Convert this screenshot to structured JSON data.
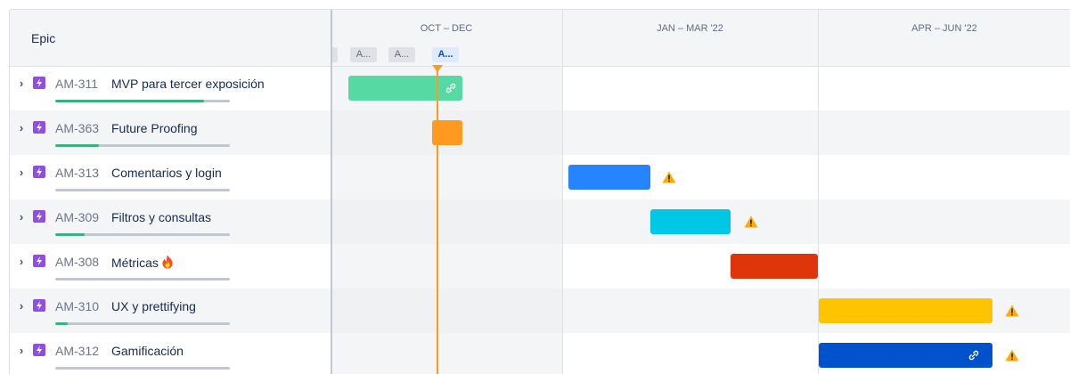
{
  "header": {
    "epic_column_title": "Epic"
  },
  "timeline": {
    "quarters": [
      {
        "label": "OCT – DEC"
      },
      {
        "label": "JAN – MAR '22"
      },
      {
        "label": "APR – JUN '22"
      }
    ],
    "months": [
      {
        "label": "A..."
      },
      {
        "label": "A..."
      },
      {
        "label": "A...",
        "current": true
      }
    ],
    "today_color": "#ff991f"
  },
  "epics": [
    {
      "key": "AM-311",
      "summary": "MVP para tercer exposición",
      "progress": 0.85,
      "progress_color": "#36b37e",
      "bar_color": "#57d9a3",
      "has_link": true,
      "has_warning": false
    },
    {
      "key": "AM-363",
      "summary": "Future Proofing",
      "progress": 0.25,
      "progress_color": "#36b37e",
      "bar_color": "#ff991f",
      "has_link": false,
      "has_warning": false
    },
    {
      "key": "AM-313",
      "summary": "Comentarios y login",
      "progress": 0.0,
      "progress_color": "#36b37e",
      "bar_color": "#2684ff",
      "has_link": false,
      "has_warning": true
    },
    {
      "key": "AM-309",
      "summary": "Filtros y consultas",
      "progress": 0.17,
      "progress_color": "#36b37e",
      "bar_color": "#00c7e6",
      "has_link": false,
      "has_warning": true
    },
    {
      "key": "AM-308",
      "summary": "Métricas",
      "summary_icon": "fire-emoji-icon",
      "progress": 0.0,
      "progress_color": "#36b37e",
      "bar_color": "#de350b",
      "has_link": false,
      "has_warning": false
    },
    {
      "key": "AM-310",
      "summary": "UX y prettifying",
      "progress": 0.07,
      "progress_color": "#36b37e",
      "bar_color": "#ffc400",
      "has_link": false,
      "has_warning": true
    },
    {
      "key": "AM-312",
      "summary": "Gamificación",
      "progress": 0.0,
      "progress_color": "#36b37e",
      "bar_color": "#0052cc",
      "has_link": true,
      "has_warning": true
    }
  ],
  "icons": {
    "expand": "chevron-right-icon",
    "epic_type": "epic-lightning-icon",
    "dependency": "link-icon",
    "warning": "warning-triangle-icon"
  },
  "colors": {
    "epic_icon": "#904ee2",
    "warning": "#ffab00"
  }
}
